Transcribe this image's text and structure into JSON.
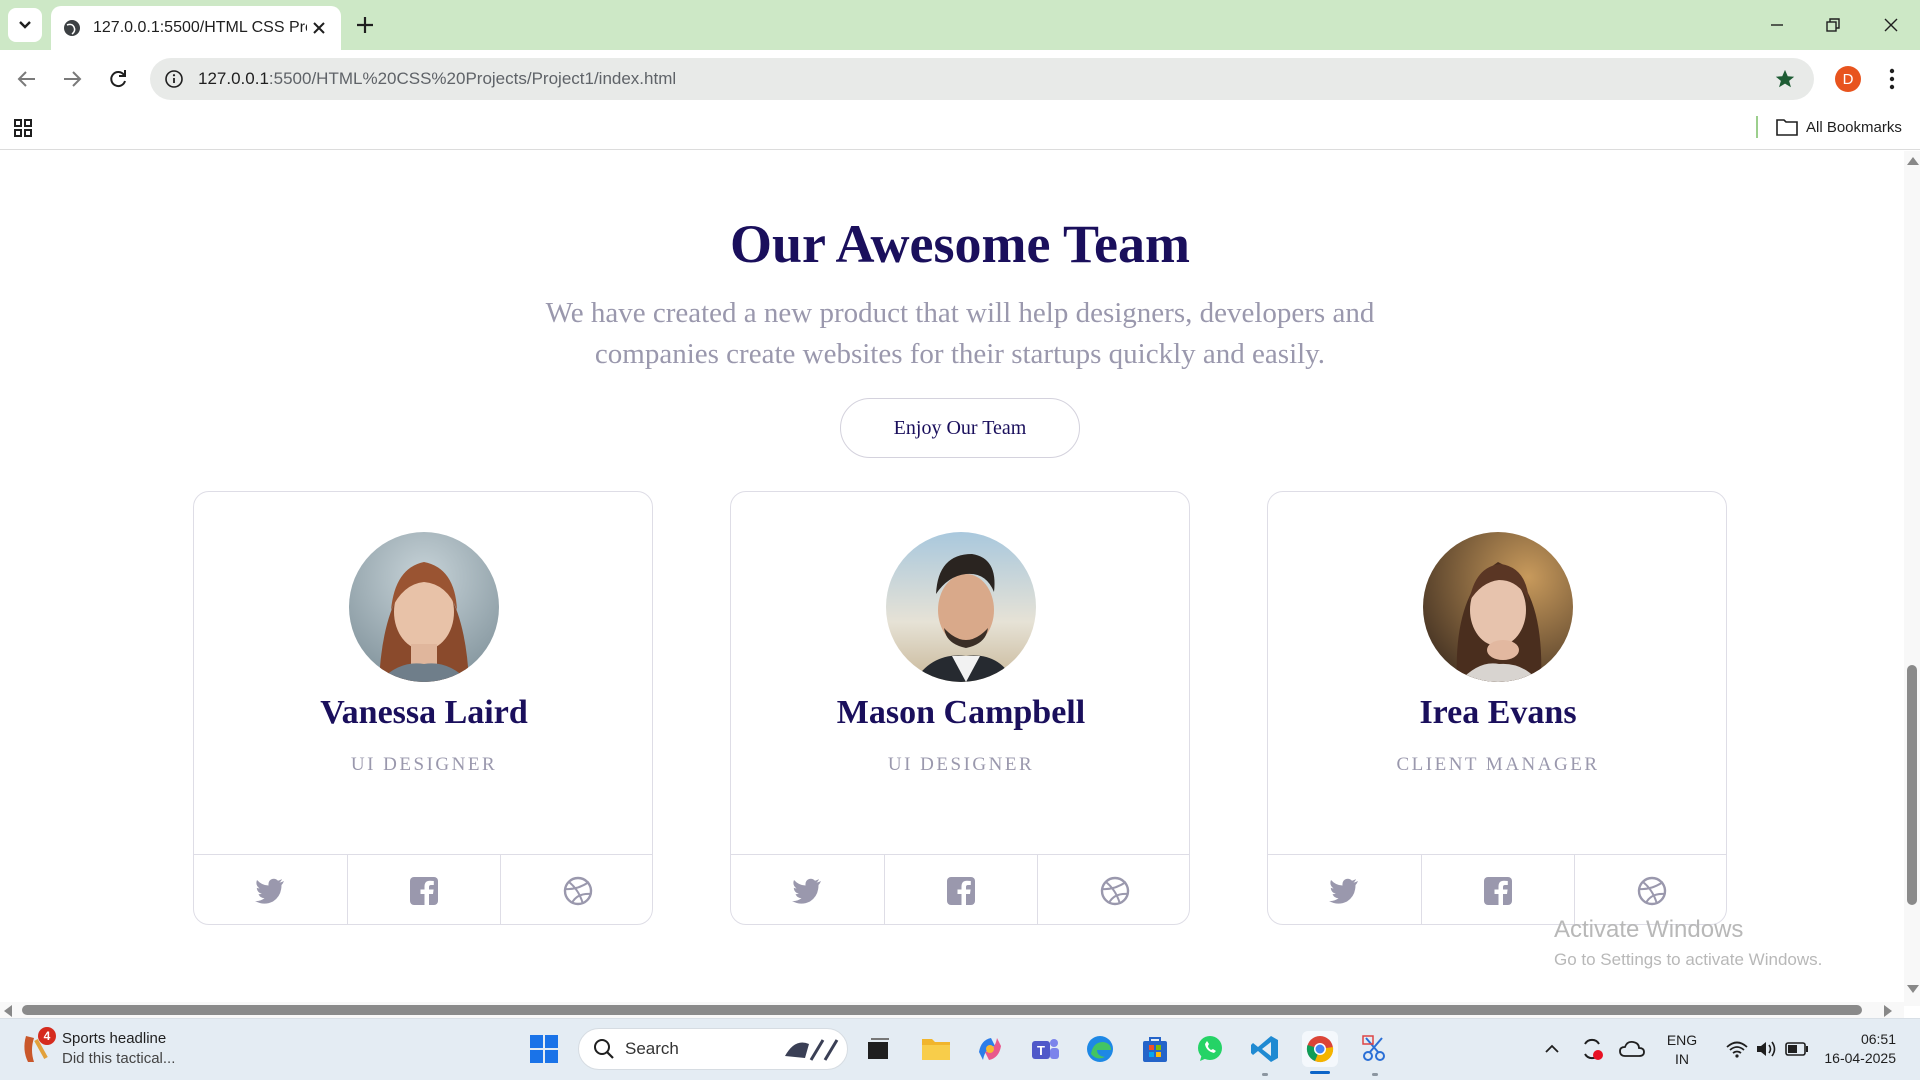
{
  "browser": {
    "tab_title": "127.0.0.1:5500/HTML CSS Proje",
    "url_host": "127.0.0.1",
    "url_rest": ":5500/HTML%20CSS%20Projects/Project1/index.html",
    "profile_initial": "D",
    "all_bookmarks": "All Bookmarks",
    "accent": "#cde8c6"
  },
  "page": {
    "title": "Our Awesome Team",
    "subtitle_line1": "We have created a new product that will help designers, developers and",
    "subtitle_line2": "companies create websites for their startups quickly and easily.",
    "cta": "Enjoy Our Team",
    "members": [
      {
        "name": "Vanessa Laird",
        "role": "UI DESIGNER",
        "socials": [
          "twitter-icon",
          "facebook-icon",
          "dribbble-icon"
        ]
      },
      {
        "name": "Mason Campbell",
        "role": "UI DESIGNER",
        "socials": [
          "twitter-icon",
          "facebook-icon",
          "dribbble-icon"
        ]
      },
      {
        "name": "Irea Evans",
        "role": "CLIENT MANAGER",
        "socials": [
          "twitter-icon",
          "facebook-icon",
          "dribbble-icon"
        ]
      }
    ],
    "title_color": "#1a0f5c",
    "muted_color": "#9a98ad"
  },
  "watermark": {
    "title": "Activate Windows",
    "subtitle": "Go to Settings to activate Windows."
  },
  "taskbar": {
    "news_badge": "4",
    "news_title": "Sports headline",
    "news_sub": "Did this tactical...",
    "search_label": "Search",
    "lang": "ENG",
    "region": "IN",
    "time": "06:51",
    "date": "16-04-2025"
  }
}
